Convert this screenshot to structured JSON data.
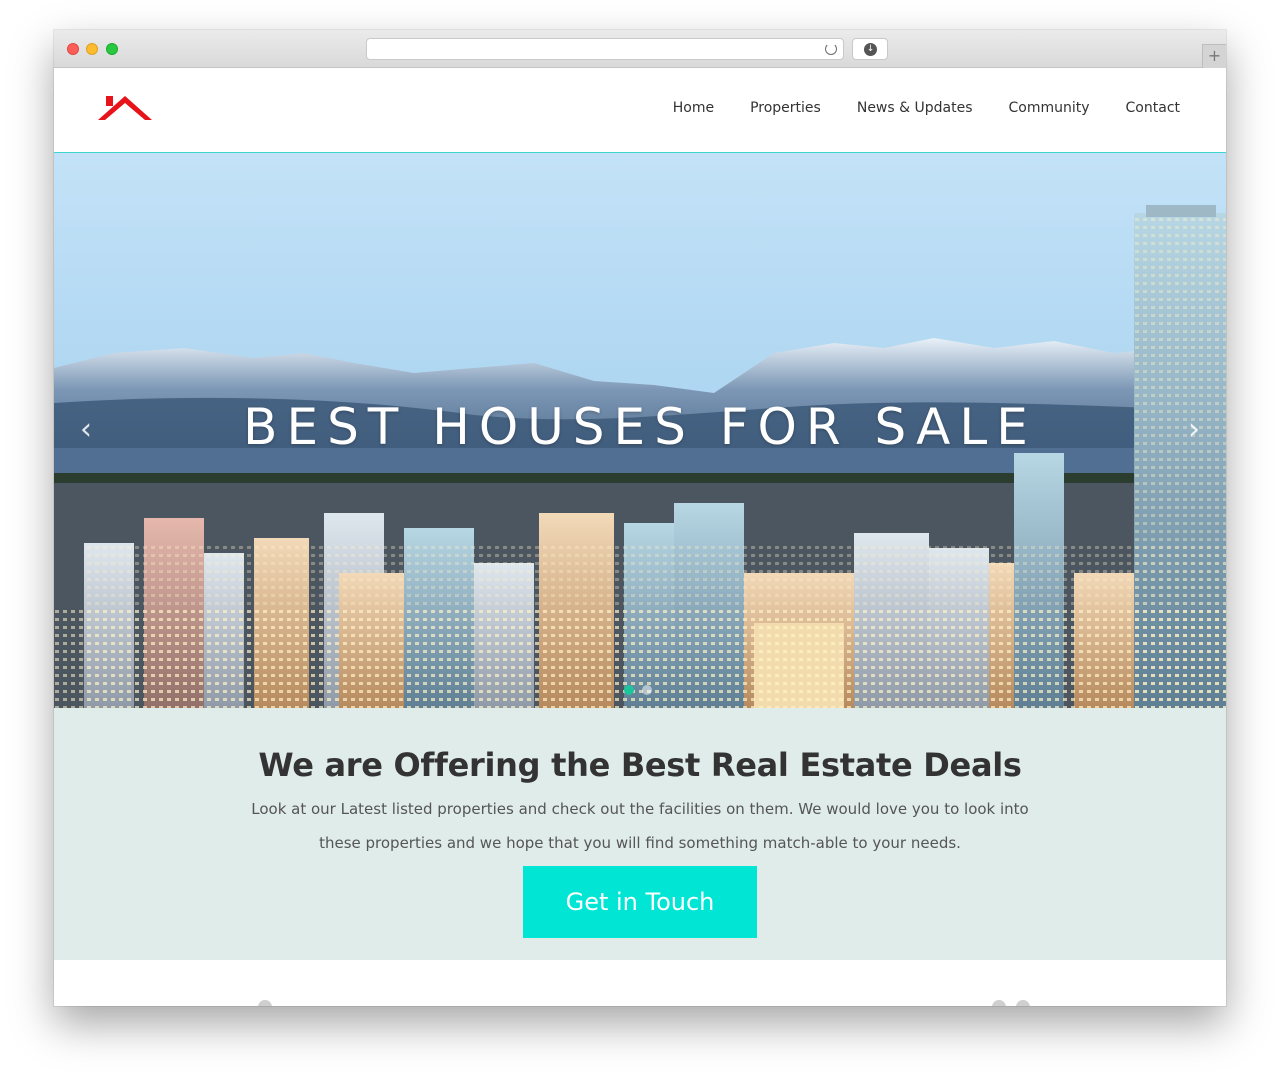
{
  "browser": {
    "url": "",
    "icons": [
      "reload-icon",
      "download-icon",
      "new-tab-icon"
    ]
  },
  "header": {
    "logo": "house-roof-logo",
    "nav": [
      {
        "label": "Home"
      },
      {
        "label": "Properties"
      },
      {
        "label": "News & Updates"
      },
      {
        "label": "Community"
      },
      {
        "label": "Contact"
      }
    ]
  },
  "hero": {
    "title": "BEST HOUSES FOR SALE",
    "prev_arrow": "‹",
    "next_arrow": "›",
    "slides": 2,
    "active_slide": 1
  },
  "offer": {
    "heading": "We are Offering the Best Real Estate Deals",
    "text": "Look at our Latest listed properties and check out the facilities on them. We would love you to look into these properties and we hope that you will find something match-able to your needs.",
    "cta_label": "Get in Touch"
  },
  "colors": {
    "accent": "#00e5d4",
    "offer_bg": "#e0ece9",
    "logo_red": "#e8121b",
    "active_dot": "#1ec49c"
  }
}
